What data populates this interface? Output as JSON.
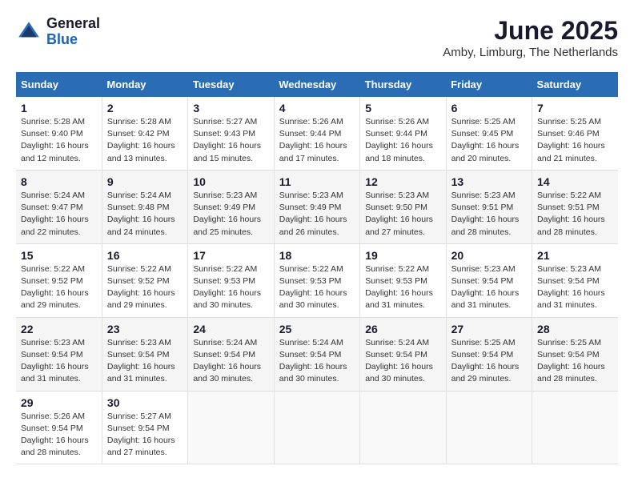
{
  "logo": {
    "general": "General",
    "blue": "Blue"
  },
  "header": {
    "month": "June 2025",
    "location": "Amby, Limburg, The Netherlands"
  },
  "weekdays": [
    "Sunday",
    "Monday",
    "Tuesday",
    "Wednesday",
    "Thursday",
    "Friday",
    "Saturday"
  ],
  "weeks": [
    [
      {
        "day": "1",
        "info": "Sunrise: 5:28 AM\nSunset: 9:40 PM\nDaylight: 16 hours\nand 12 minutes."
      },
      {
        "day": "2",
        "info": "Sunrise: 5:28 AM\nSunset: 9:42 PM\nDaylight: 16 hours\nand 13 minutes."
      },
      {
        "day": "3",
        "info": "Sunrise: 5:27 AM\nSunset: 9:43 PM\nDaylight: 16 hours\nand 15 minutes."
      },
      {
        "day": "4",
        "info": "Sunrise: 5:26 AM\nSunset: 9:44 PM\nDaylight: 16 hours\nand 17 minutes."
      },
      {
        "day": "5",
        "info": "Sunrise: 5:26 AM\nSunset: 9:44 PM\nDaylight: 16 hours\nand 18 minutes."
      },
      {
        "day": "6",
        "info": "Sunrise: 5:25 AM\nSunset: 9:45 PM\nDaylight: 16 hours\nand 20 minutes."
      },
      {
        "day": "7",
        "info": "Sunrise: 5:25 AM\nSunset: 9:46 PM\nDaylight: 16 hours\nand 21 minutes."
      }
    ],
    [
      {
        "day": "8",
        "info": "Sunrise: 5:24 AM\nSunset: 9:47 PM\nDaylight: 16 hours\nand 22 minutes."
      },
      {
        "day": "9",
        "info": "Sunrise: 5:24 AM\nSunset: 9:48 PM\nDaylight: 16 hours\nand 24 minutes."
      },
      {
        "day": "10",
        "info": "Sunrise: 5:23 AM\nSunset: 9:49 PM\nDaylight: 16 hours\nand 25 minutes."
      },
      {
        "day": "11",
        "info": "Sunrise: 5:23 AM\nSunset: 9:49 PM\nDaylight: 16 hours\nand 26 minutes."
      },
      {
        "day": "12",
        "info": "Sunrise: 5:23 AM\nSunset: 9:50 PM\nDaylight: 16 hours\nand 27 minutes."
      },
      {
        "day": "13",
        "info": "Sunrise: 5:23 AM\nSunset: 9:51 PM\nDaylight: 16 hours\nand 28 minutes."
      },
      {
        "day": "14",
        "info": "Sunrise: 5:22 AM\nSunset: 9:51 PM\nDaylight: 16 hours\nand 28 minutes."
      }
    ],
    [
      {
        "day": "15",
        "info": "Sunrise: 5:22 AM\nSunset: 9:52 PM\nDaylight: 16 hours\nand 29 minutes."
      },
      {
        "day": "16",
        "info": "Sunrise: 5:22 AM\nSunset: 9:52 PM\nDaylight: 16 hours\nand 29 minutes."
      },
      {
        "day": "17",
        "info": "Sunrise: 5:22 AM\nSunset: 9:53 PM\nDaylight: 16 hours\nand 30 minutes."
      },
      {
        "day": "18",
        "info": "Sunrise: 5:22 AM\nSunset: 9:53 PM\nDaylight: 16 hours\nand 30 minutes."
      },
      {
        "day": "19",
        "info": "Sunrise: 5:22 AM\nSunset: 9:53 PM\nDaylight: 16 hours\nand 31 minutes."
      },
      {
        "day": "20",
        "info": "Sunrise: 5:23 AM\nSunset: 9:54 PM\nDaylight: 16 hours\nand 31 minutes."
      },
      {
        "day": "21",
        "info": "Sunrise: 5:23 AM\nSunset: 9:54 PM\nDaylight: 16 hours\nand 31 minutes."
      }
    ],
    [
      {
        "day": "22",
        "info": "Sunrise: 5:23 AM\nSunset: 9:54 PM\nDaylight: 16 hours\nand 31 minutes."
      },
      {
        "day": "23",
        "info": "Sunrise: 5:23 AM\nSunset: 9:54 PM\nDaylight: 16 hours\nand 31 minutes."
      },
      {
        "day": "24",
        "info": "Sunrise: 5:24 AM\nSunset: 9:54 PM\nDaylight: 16 hours\nand 30 minutes."
      },
      {
        "day": "25",
        "info": "Sunrise: 5:24 AM\nSunset: 9:54 PM\nDaylight: 16 hours\nand 30 minutes."
      },
      {
        "day": "26",
        "info": "Sunrise: 5:24 AM\nSunset: 9:54 PM\nDaylight: 16 hours\nand 30 minutes."
      },
      {
        "day": "27",
        "info": "Sunrise: 5:25 AM\nSunset: 9:54 PM\nDaylight: 16 hours\nand 29 minutes."
      },
      {
        "day": "28",
        "info": "Sunrise: 5:25 AM\nSunset: 9:54 PM\nDaylight: 16 hours\nand 28 minutes."
      }
    ],
    [
      {
        "day": "29",
        "info": "Sunrise: 5:26 AM\nSunset: 9:54 PM\nDaylight: 16 hours\nand 28 minutes."
      },
      {
        "day": "30",
        "info": "Sunrise: 5:27 AM\nSunset: 9:54 PM\nDaylight: 16 hours\nand 27 minutes."
      },
      {
        "day": "",
        "info": ""
      },
      {
        "day": "",
        "info": ""
      },
      {
        "day": "",
        "info": ""
      },
      {
        "day": "",
        "info": ""
      },
      {
        "day": "",
        "info": ""
      }
    ]
  ]
}
